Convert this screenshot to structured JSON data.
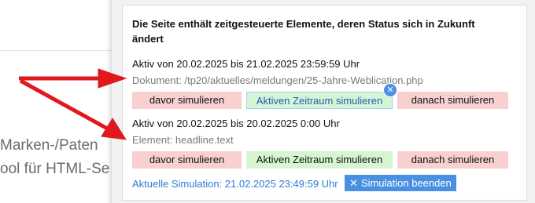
{
  "background": {
    "line1": "Marken-/Paten",
    "line2": "ool für HTML-Se"
  },
  "panel": {
    "title": "Die Seite enthält zeitgesteuerte Elemente, deren Status sich in Zukunft ändert",
    "entries": [
      {
        "period": "Aktiv von 20.02.2025 bis 21.02.2025 23:59:59 Uhr",
        "source": "Dokument: /tp20/aktuelles/meldungen/25-Jahre-Weblication.php",
        "before_label": "davor simulieren",
        "active_label": "Aktiven Zeitraum simulieren",
        "after_label": "danach simulieren"
      },
      {
        "period": "Aktiv von 20.02.2025 bis 20.02.2025 0:00 Uhr",
        "source": "Element: headline.text",
        "before_label": "davor simulieren",
        "active_label": "Aktiven Zeitraum simulieren",
        "after_label": "danach simulieren"
      }
    ],
    "close_badge": "✕",
    "simulation_status": "Aktuelle Simulation: 21.02.2025 23:49:59 Uhr",
    "end_simulation_label": "Simulation beenden",
    "end_simulation_icon": "✕"
  },
  "colors": {
    "red_button": "#f9d0d0",
    "green_button": "#d8f5d3",
    "accent_blue": "#4a90e2",
    "arrow": "#e0191f"
  },
  "icons": {
    "close_badge": "close-icon",
    "end_simulation": "close-icon"
  }
}
